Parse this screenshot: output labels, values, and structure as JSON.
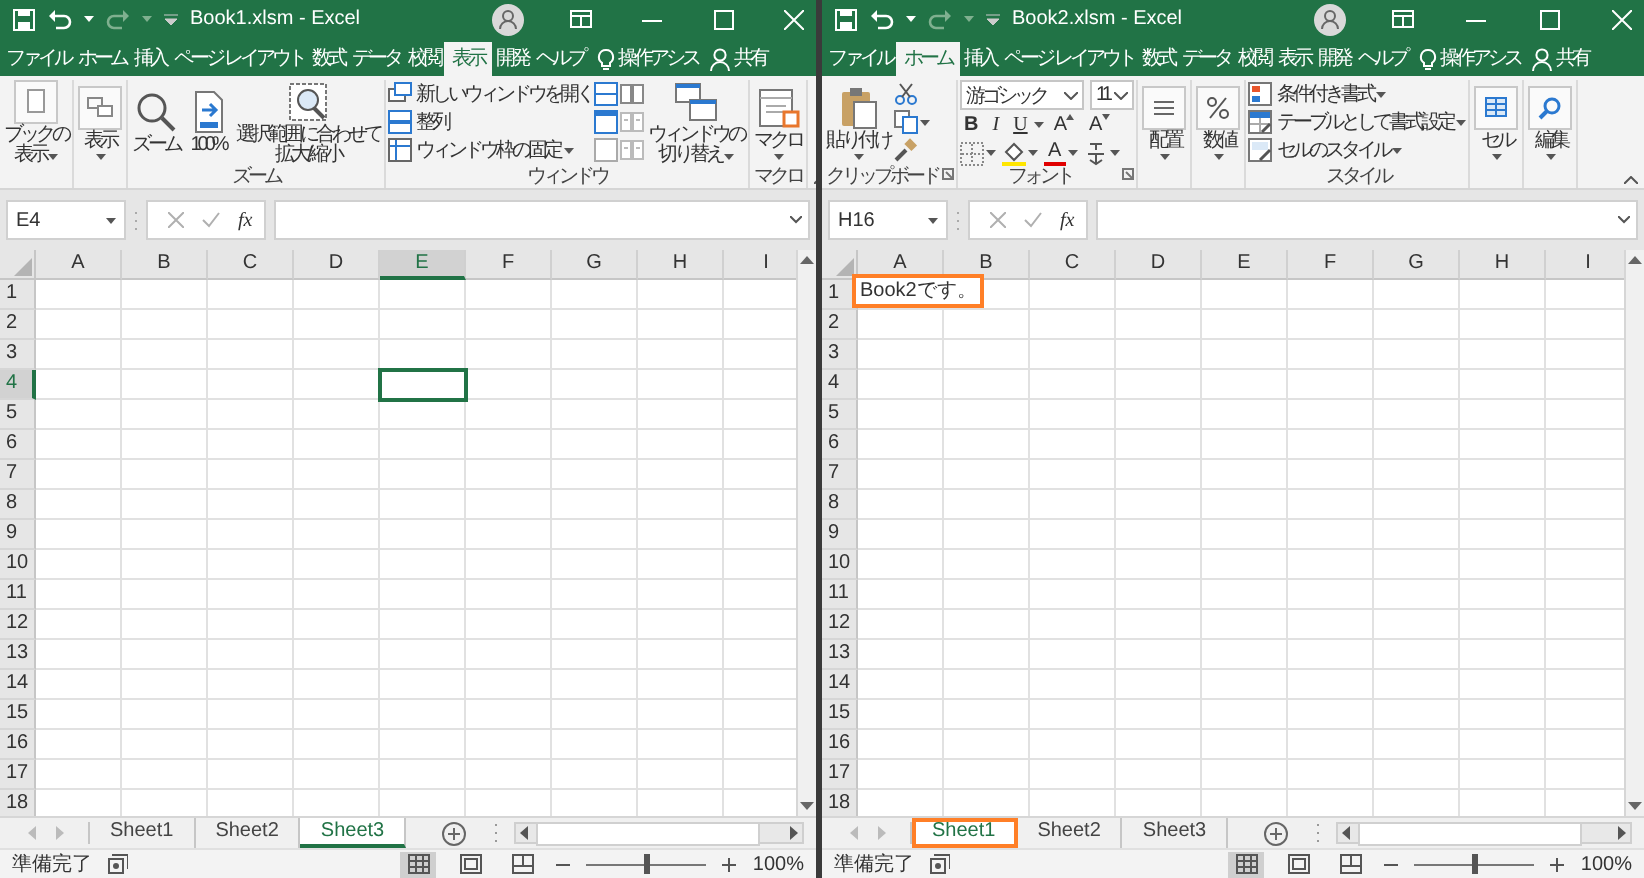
{
  "windows": [
    {
      "title": "Book1.xlsm - Excel",
      "tabs": [
        {
          "label": "ファイル",
          "kind": "tab",
          "selected": false
        },
        {
          "label": "ホーム",
          "kind": "tab",
          "selected": false
        },
        {
          "label": "挿入",
          "kind": "tab",
          "selected": false
        },
        {
          "label": "ページ レイアウト",
          "kind": "tab",
          "selected": false
        },
        {
          "label": "数式",
          "kind": "tab",
          "selected": false
        },
        {
          "label": "データ",
          "kind": "tab",
          "selected": false
        },
        {
          "label": "校閲",
          "kind": "tab",
          "selected": false
        },
        {
          "label": "表示",
          "kind": "tab",
          "selected": true
        },
        {
          "label": "開発",
          "kind": "tab",
          "selected": false
        },
        {
          "label": "ヘルプ",
          "kind": "tab",
          "selected": false
        },
        {
          "label": "操作アシス",
          "kind": "assist",
          "selected": false
        },
        {
          "label": "共有",
          "kind": "share",
          "selected": false
        }
      ],
      "ribbon": {
        "groups": [
          {
            "kind": "columns",
            "lines": [
              [
                {
                  "kind": "large",
                  "lines": [
                    "ブックの",
                    "表示"
                  ],
                  "dropdown": true
                }
              ]
            ]
          },
          {
            "kind": "columns",
            "lines": [
              [
                {
                  "kind": "large",
                  "lines": [
                    "表示"
                  ],
                  "dropdown": true
                }
              ]
            ]
          },
          {
            "kind": "columns",
            "label": "ズーム",
            "lines": [
              [
                {
                  "kind": "large",
                  "lines": [
                    "ズーム"
                  ]
                }
              ],
              [
                {
                  "kind": "large",
                  "lines": [
                    "100%"
                  ]
                }
              ],
              [
                {
                  "kind": "large",
                  "lines": [
                    "選択範囲に合わせて",
                    "拡大/縮小"
                  ]
                }
              ]
            ]
          },
          {
            "kind": "columns",
            "label": "ウィンドウ",
            "lines": [
              [
                {
                  "kind": "small",
                  "label": "新しいウィンドウを開く"
                },
                {
                  "kind": "small",
                  "label": "整列"
                },
                {
                  "kind": "small",
                  "label": "ウィンドウ枠の固定",
                  "dropdown": true
                }
              ],
              [
                {
                  "kind": "icon"
                },
                {
                  "kind": "icon"
                },
                {
                  "kind": "icon"
                }
              ],
              [
                {
                  "kind": "icon"
                },
                {
                  "kind": "icon"
                },
                {
                  "kind": "icon"
                }
              ],
              [
                {
                  "kind": "large",
                  "lines": [
                    "ウィンドウの",
                    "切り替え"
                  ],
                  "dropdown": true
                }
              ]
            ]
          },
          {
            "kind": "columns",
            "label": "マクロ",
            "lines": [
              [
                {
                  "kind": "large",
                  "lines": [
                    "マクロ"
                  ],
                  "dropdown": true
                }
              ]
            ]
          }
        ]
      },
      "name_box": "E4",
      "function_label": "fx",
      "columns": [
        {
          "label": "A",
          "selected": false
        },
        {
          "label": "B",
          "selected": false
        },
        {
          "label": "C",
          "selected": false
        },
        {
          "label": "D",
          "selected": false
        },
        {
          "label": "E",
          "selected": true
        },
        {
          "label": "F",
          "selected": false
        },
        {
          "label": "G",
          "selected": false
        },
        {
          "label": "H",
          "selected": false
        },
        {
          "label": "I",
          "selected": false
        }
      ],
      "rows": [
        {
          "label": "1",
          "selected": false
        },
        {
          "label": "2",
          "selected": false
        },
        {
          "label": "3",
          "selected": false
        },
        {
          "label": "4",
          "selected": true
        },
        {
          "label": "5",
          "selected": false
        },
        {
          "label": "6",
          "selected": false
        },
        {
          "label": "7",
          "selected": false
        },
        {
          "label": "8",
          "selected": false
        },
        {
          "label": "9",
          "selected": false
        },
        {
          "label": "10",
          "selected": false
        },
        {
          "label": "11",
          "selected": false
        },
        {
          "label": "12",
          "selected": false
        },
        {
          "label": "13",
          "selected": false
        },
        {
          "label": "14",
          "selected": false
        },
        {
          "label": "15",
          "selected": false
        },
        {
          "label": "16",
          "selected": false
        },
        {
          "label": "17",
          "selected": false
        },
        {
          "label": "18",
          "selected": false
        }
      ],
      "sheets": [
        {
          "name": "Sheet1",
          "selected": false,
          "highlighted": false
        },
        {
          "name": "Sheet2",
          "selected": false,
          "highlighted": false
        },
        {
          "name": "Sheet3",
          "selected": true,
          "highlighted": false
        }
      ],
      "status": "準備完了",
      "views": [
        {
          "selected": true
        },
        {
          "selected": false
        },
        {
          "selected": false
        }
      ],
      "zoom": {
        "level": 0.5,
        "reading": "100%"
      }
    },
    {
      "title": "Book2.xlsm - Excel",
      "tabs": [
        {
          "label": "ファイル",
          "kind": "tab",
          "selected": false
        },
        {
          "label": "ホーム",
          "kind": "tab",
          "selected": true
        },
        {
          "label": "挿入",
          "kind": "tab",
          "selected": false
        },
        {
          "label": "ページ レイアウト",
          "kind": "tab",
          "selected": false
        },
        {
          "label": "数式",
          "kind": "tab",
          "selected": false
        },
        {
          "label": "データ",
          "kind": "tab",
          "selected": false
        },
        {
          "label": "校閲",
          "kind": "tab",
          "selected": false
        },
        {
          "label": "表示",
          "kind": "tab",
          "selected": false
        },
        {
          "label": "開発",
          "kind": "tab",
          "selected": false
        },
        {
          "label": "ヘルプ",
          "kind": "tab",
          "selected": false
        },
        {
          "label": "操作アシス",
          "kind": "assist",
          "selected": false
        },
        {
          "label": "共有",
          "kind": "share",
          "selected": false
        }
      ],
      "ribbon": {
        "groups": [
          {
            "kind": "columns",
            "label": "クリップボード",
            "launcher": true,
            "lines": [
              [
                {
                  "kind": "large",
                  "lines": [
                    "貼り付け"
                  ],
                  "dropdown": true
                }
              ],
              [
                {
                  "kind": "icon"
                },
                {
                  "kind": "icon",
                  "dropdown": true
                },
                {
                  "kind": "icon"
                }
              ]
            ]
          },
          {
            "kind": "rows",
            "label": "フォント",
            "launcher": true,
            "lines": [
              [
                {
                  "kind": "combo",
                  "value": "游ゴシック"
                },
                {
                  "kind": "combo",
                  "value": "11"
                }
              ],
              [
                {
                  "kind": "bold",
                  "label": "B"
                },
                {
                  "kind": "italic",
                  "label": "I"
                },
                {
                  "kind": "underline",
                  "label": "U",
                  "dropdown": true
                },
                {
                  "kind": "grow",
                  "label": "A"
                },
                {
                  "kind": "shrink",
                  "label": "A"
                }
              ],
              [
                {
                  "kind": "icon",
                  "dropdown": true
                },
                {
                  "kind": "icon",
                  "dropdown": true
                },
                {
                  "kind": "color",
                  "label": "A",
                  "dropdown": true
                },
                {
                  "kind": "icon",
                  "dropdown": true
                }
              ]
            ]
          },
          {
            "kind": "columns",
            "lines": [
              [
                {
                  "kind": "large",
                  "lines": [
                    "配置"
                  ],
                  "dropdown": true
                }
              ]
            ]
          },
          {
            "kind": "columns",
            "lines": [
              [
                {
                  "kind": "large",
                  "lines": [
                    "数値"
                  ],
                  "dropdown": true
                }
              ]
            ]
          },
          {
            "kind": "columns",
            "label": "スタイル",
            "lines": [
              [
                {
                  "kind": "small",
                  "label": "条件付き書式",
                  "dropdown": true
                },
                {
                  "kind": "small",
                  "label": "テーブルとして書式設定",
                  "dropdown": true
                },
                {
                  "kind": "small",
                  "label": "セルのスタイル",
                  "dropdown": true
                }
              ]
            ]
          },
          {
            "kind": "columns",
            "lines": [
              [
                {
                  "kind": "large",
                  "lines": [
                    "セル"
                  ],
                  "dropdown": true
                }
              ]
            ]
          },
          {
            "kind": "columns",
            "lines": [
              [
                {
                  "kind": "large",
                  "lines": [
                    "編集"
                  ],
                  "dropdown": true
                }
              ]
            ]
          }
        ]
      },
      "name_box": "H16",
      "function_label": "fx",
      "columns": [
        {
          "label": "A",
          "selected": false
        },
        {
          "label": "B",
          "selected": false
        },
        {
          "label": "C",
          "selected": false
        },
        {
          "label": "D",
          "selected": false
        },
        {
          "label": "E",
          "selected": false
        },
        {
          "label": "F",
          "selected": false
        },
        {
          "label": "G",
          "selected": false
        },
        {
          "label": "H",
          "selected": false
        },
        {
          "label": "I",
          "selected": false
        }
      ],
      "rows": [
        {
          "label": "1",
          "selected": false,
          "cells": [
            {
              "text": "Book2です。",
              "highlighted": true
            }
          ]
        },
        {
          "label": "2",
          "selected": false
        },
        {
          "label": "3",
          "selected": false
        },
        {
          "label": "4",
          "selected": false
        },
        {
          "label": "5",
          "selected": false
        },
        {
          "label": "6",
          "selected": false
        },
        {
          "label": "7",
          "selected": false
        },
        {
          "label": "8",
          "selected": false
        },
        {
          "label": "9",
          "selected": false
        },
        {
          "label": "10",
          "selected": false
        },
        {
          "label": "11",
          "selected": false
        },
        {
          "label": "12",
          "selected": false
        },
        {
          "label": "13",
          "selected": false
        },
        {
          "label": "14",
          "selected": false
        },
        {
          "label": "15",
          "selected": false
        },
        {
          "label": "16",
          "selected": false
        },
        {
          "label": "17",
          "selected": false
        },
        {
          "label": "18",
          "selected": false
        }
      ],
      "sheets": [
        {
          "name": "Sheet1",
          "selected": true,
          "highlighted": true
        },
        {
          "name": "Sheet2",
          "selected": false,
          "highlighted": false
        },
        {
          "name": "Sheet3",
          "selected": false,
          "highlighted": false
        }
      ],
      "status": "準備完了",
      "views": [
        {
          "selected": true
        },
        {
          "selected": false
        },
        {
          "selected": false
        }
      ],
      "zoom": {
        "level": 0.5,
        "reading": "100%"
      }
    }
  ]
}
